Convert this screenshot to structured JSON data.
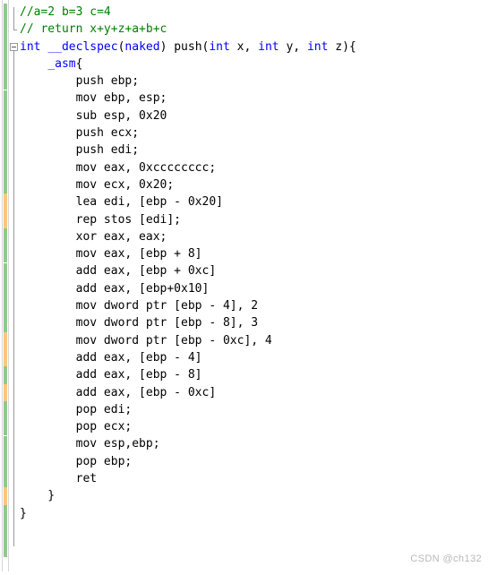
{
  "editor": {
    "language": "cpp",
    "background": "#ffffff",
    "colors": {
      "comment": "#008000",
      "keyword": "#0000ff",
      "plain": "#000000",
      "saved_change": "#8fc98f",
      "unsaved_change": "#fbc87d",
      "fold_marker": "#9a9a9a",
      "watermark": "#b8b8b8"
    },
    "lines": [
      {
        "n": 1,
        "indent": 0,
        "fold": "none",
        "track": "saved",
        "tokens": [
          {
            "t": "//a=2 b=3 c=4",
            "c": "cmt"
          }
        ]
      },
      {
        "n": 2,
        "indent": 0,
        "fold": "end",
        "track": "saved",
        "tokens": [
          {
            "t": "// return x+y+z+a+b+c",
            "c": "cmt"
          }
        ]
      },
      {
        "n": 3,
        "indent": 0,
        "fold": "open",
        "track": "saved",
        "tokens": [
          {
            "t": "int",
            "c": "kw"
          },
          {
            "t": " ",
            "c": "pln"
          },
          {
            "t": "__declspec",
            "c": "kw"
          },
          {
            "t": "(",
            "c": "pln"
          },
          {
            "t": "naked",
            "c": "kw"
          },
          {
            "t": ") push(",
            "c": "pln"
          },
          {
            "t": "int",
            "c": "kw"
          },
          {
            "t": " x, ",
            "c": "pln"
          },
          {
            "t": "int",
            "c": "kw"
          },
          {
            "t": " y, ",
            "c": "pln"
          },
          {
            "t": "int",
            "c": "kw"
          },
          {
            "t": " z){",
            "c": "pln"
          }
        ]
      },
      {
        "n": 4,
        "indent": 1,
        "fold": "none",
        "track": "saved",
        "tokens": [
          {
            "t": "    ",
            "c": "pln"
          },
          {
            "t": "_asm",
            "c": "kw"
          },
          {
            "t": "{",
            "c": "pln"
          }
        ]
      },
      {
        "n": 5,
        "indent": 2,
        "fold": "none",
        "track": "saved",
        "tokens": [
          {
            "t": "        push ebp;",
            "c": "pln"
          }
        ]
      },
      {
        "n": 6,
        "indent": 2,
        "fold": "none",
        "track": "saved",
        "tokens": [
          {
            "t": "        mov ebp, esp;",
            "c": "pln"
          }
        ]
      },
      {
        "n": 7,
        "indent": 2,
        "fold": "none",
        "track": "saved",
        "tokens": [
          {
            "t": "        sub esp, 0x20",
            "c": "pln"
          }
        ]
      },
      {
        "n": 8,
        "indent": 2,
        "fold": "none",
        "track": "saved",
        "tokens": [
          {
            "t": "        push ecx;",
            "c": "pln"
          }
        ]
      },
      {
        "n": 9,
        "indent": 2,
        "fold": "none",
        "track": "saved",
        "tokens": [
          {
            "t": "        push edi;",
            "c": "pln"
          }
        ]
      },
      {
        "n": 10,
        "indent": 2,
        "fold": "none",
        "track": "saved",
        "tokens": [
          {
            "t": "        mov eax, 0xcccccccc;",
            "c": "pln"
          }
        ]
      },
      {
        "n": 11,
        "indent": 2,
        "fold": "none",
        "track": "saved",
        "tokens": [
          {
            "t": "        mov ecx, 0x20;",
            "c": "pln"
          }
        ]
      },
      {
        "n": 12,
        "indent": 2,
        "fold": "none",
        "track": "unsaved",
        "tokens": [
          {
            "t": "        lea edi, [ebp - 0x20]",
            "c": "pln"
          }
        ]
      },
      {
        "n": 13,
        "indent": 2,
        "fold": "none",
        "track": "unsaved",
        "tokens": [
          {
            "t": "        rep stos [edi];",
            "c": "pln"
          }
        ]
      },
      {
        "n": 14,
        "indent": 2,
        "fold": "none",
        "track": "saved",
        "tokens": [
          {
            "t": "        xor eax, eax;",
            "c": "pln"
          }
        ]
      },
      {
        "n": 15,
        "indent": 2,
        "fold": "none",
        "track": "saved",
        "tokens": [
          {
            "t": "        mov eax, [ebp + 8]",
            "c": "pln"
          }
        ]
      },
      {
        "n": 16,
        "indent": 2,
        "fold": "none",
        "track": "saved",
        "tokens": [
          {
            "t": "        add eax, [ebp + 0xc]",
            "c": "pln"
          }
        ]
      },
      {
        "n": 17,
        "indent": 2,
        "fold": "none",
        "track": "saved",
        "tokens": [
          {
            "t": "        add eax, [ebp+0x10]",
            "c": "pln"
          }
        ]
      },
      {
        "n": 18,
        "indent": 2,
        "fold": "none",
        "track": "saved",
        "tokens": [
          {
            "t": "        mov dword ptr [ebp - 4], 2",
            "c": "pln"
          }
        ]
      },
      {
        "n": 19,
        "indent": 2,
        "fold": "none",
        "track": "saved",
        "tokens": [
          {
            "t": "        mov dword ptr [ebp - 8], 3",
            "c": "pln"
          }
        ]
      },
      {
        "n": 20,
        "indent": 2,
        "fold": "none",
        "track": "unsaved",
        "tokens": [
          {
            "t": "        mov dword ptr [ebp - 0xc], 4",
            "c": "pln"
          }
        ]
      },
      {
        "n": 21,
        "indent": 2,
        "fold": "none",
        "track": "unsaved",
        "tokens": [
          {
            "t": "        add eax, [ebp - 4]",
            "c": "pln"
          }
        ]
      },
      {
        "n": 22,
        "indent": 2,
        "fold": "none",
        "track": "saved",
        "tokens": [
          {
            "t": "        add eax, [ebp - 8]",
            "c": "pln"
          }
        ]
      },
      {
        "n": 23,
        "indent": 2,
        "fold": "none",
        "track": "unsaved",
        "tokens": [
          {
            "t": "        add eax, [ebp - 0xc]",
            "c": "pln"
          }
        ]
      },
      {
        "n": 24,
        "indent": 2,
        "fold": "none",
        "track": "saved",
        "tokens": [
          {
            "t": "        pop edi;",
            "c": "pln"
          }
        ]
      },
      {
        "n": 25,
        "indent": 2,
        "fold": "none",
        "track": "saved",
        "tokens": [
          {
            "t": "        pop ecx;",
            "c": "pln"
          }
        ]
      },
      {
        "n": 26,
        "indent": 2,
        "fold": "none",
        "track": "saved",
        "tokens": [
          {
            "t": "        mov esp,ebp;",
            "c": "pln"
          }
        ]
      },
      {
        "n": 27,
        "indent": 2,
        "fold": "none",
        "track": "saved",
        "tokens": [
          {
            "t": "        pop ebp;",
            "c": "pln"
          }
        ]
      },
      {
        "n": 28,
        "indent": 2,
        "fold": "none",
        "track": "saved",
        "tokens": [
          {
            "t": "        ret",
            "c": "pln"
          }
        ]
      },
      {
        "n": 29,
        "indent": 1,
        "fold": "none",
        "track": "unsaved",
        "tokens": [
          {
            "t": "    }",
            "c": "pln"
          }
        ]
      },
      {
        "n": 30,
        "indent": 0,
        "fold": "none",
        "track": "saved",
        "tokens": [
          {
            "t": "}",
            "c": "pln"
          }
        ]
      },
      {
        "n": 31,
        "indent": 0,
        "fold": "none",
        "track": "saved",
        "tokens": [
          {
            "t": "",
            "c": "pln"
          }
        ]
      },
      {
        "n": 32,
        "indent": 0,
        "fold": "none",
        "track": "saved",
        "tokens": [
          {
            "t": "",
            "c": "pln"
          }
        ]
      }
    ]
  },
  "watermark": {
    "text": "CSDN @ch132"
  }
}
